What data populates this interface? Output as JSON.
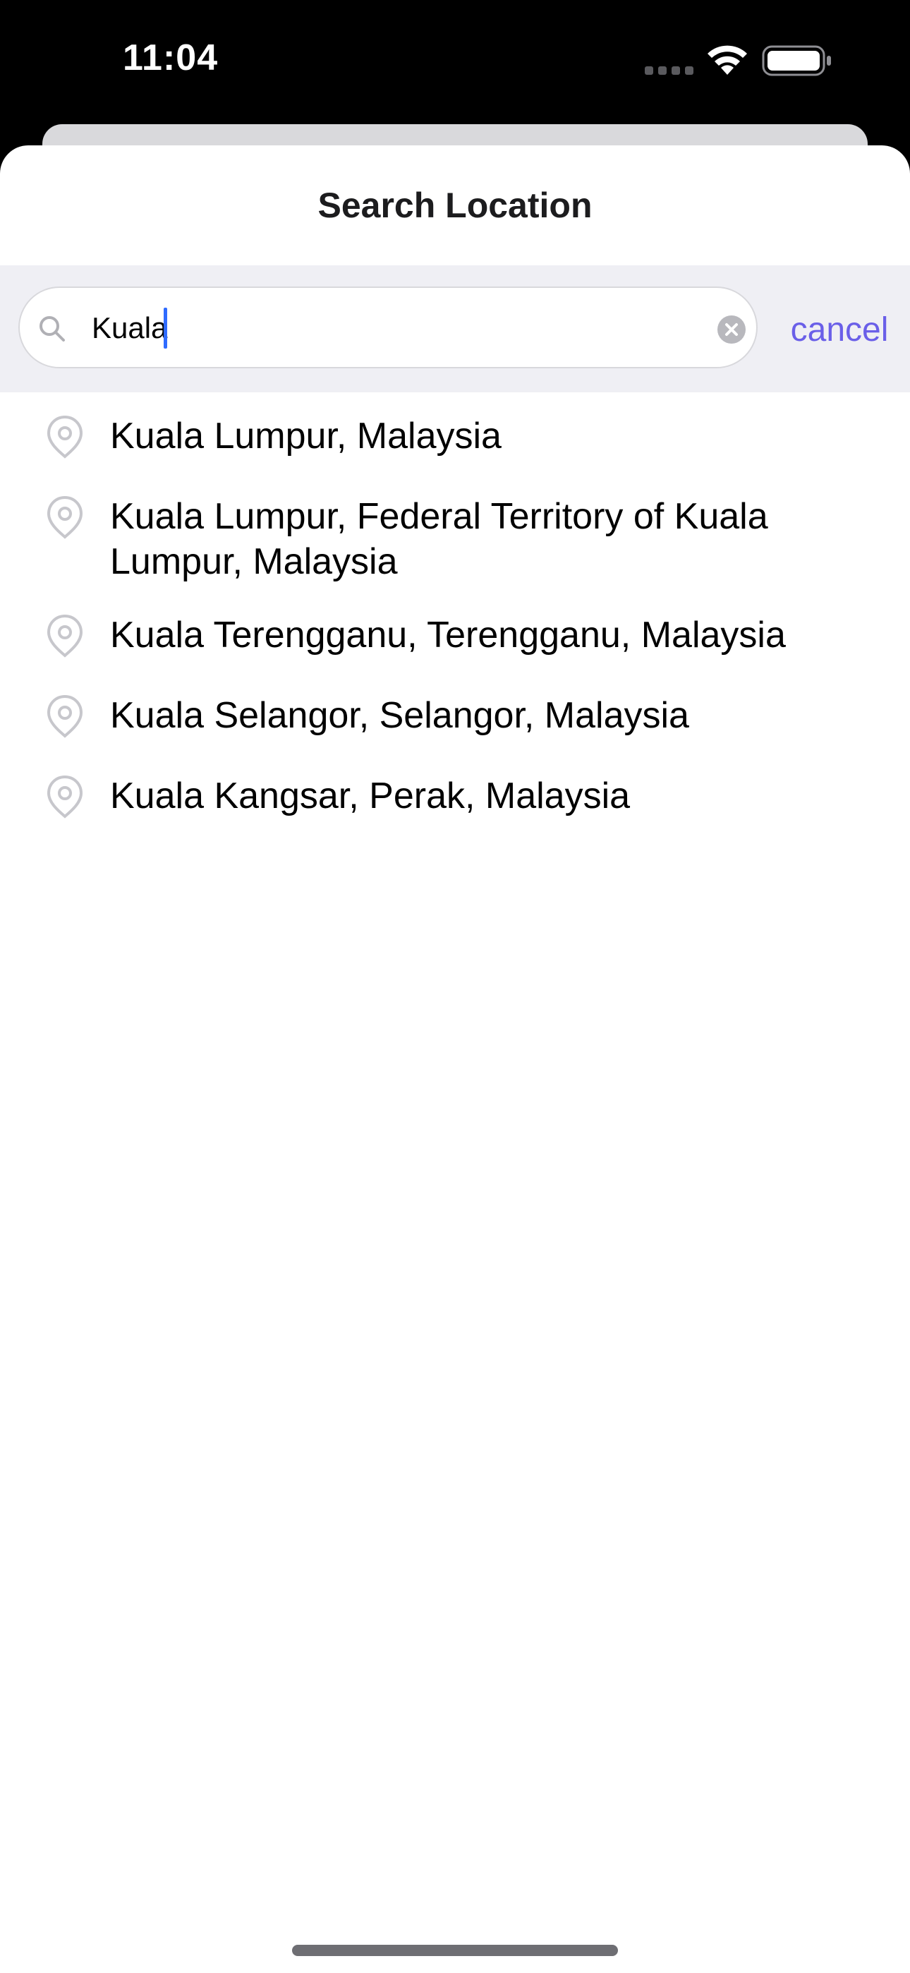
{
  "status_bar": {
    "time": "11:04"
  },
  "sheet": {
    "title": "Search Location"
  },
  "search": {
    "value": "Kuala",
    "cancel_label": "cancel"
  },
  "results": [
    {
      "label": "Kuala Lumpur, Malaysia"
    },
    {
      "label": "Kuala Lumpur, Federal Territory of Kuala Lumpur, Malaysia"
    },
    {
      "label": "Kuala Terengganu, Terengganu, Malaysia"
    },
    {
      "label": "Kuala Selangor, Selangor, Malaysia"
    },
    {
      "label": "Kuala Kangsar, Perak, Malaysia"
    }
  ],
  "colors": {
    "accent": "#6a5fe8",
    "caret": "#2f6bff",
    "search_bar_background": "#efeff4",
    "pin_icon": "#c7c7cc"
  },
  "icons": {
    "search": "search-icon",
    "clear": "clear-icon",
    "result": "location-pin-icon",
    "wifi": "wifi-icon",
    "battery": "battery-icon",
    "signal": "cellular-signal-icon"
  }
}
